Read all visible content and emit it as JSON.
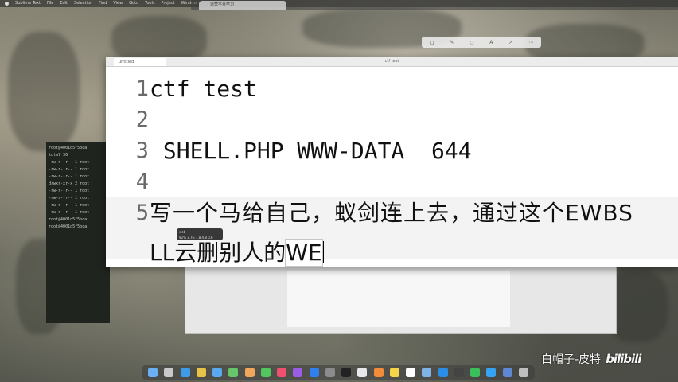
{
  "menubar": {
    "app_name": "Sublime Text",
    "items": [
      "File",
      "Edit",
      "Selection",
      "Find",
      "View",
      "Goto",
      "Tools",
      "Project",
      "Window"
    ]
  },
  "browser": {
    "tab_title": "运营平台学习",
    "toolbar_icons": [
      "crop-icon",
      "pen-icon",
      "shapes-icon",
      "text-icon",
      "arrow-icon",
      "more-icon"
    ]
  },
  "terminal": {
    "lines": [
      "root@4001d5f5bca:",
      "total 36",
      "-rw-r--r-- 1 root",
      "-rw-r--r-- 1 root",
      "-rw-r--r-- 1 root",
      "drwxr-xr-x 2 root",
      "-rw-r--r-- 1 root",
      "-rw-r--r-- 1 root",
      "-rw-r--r-- 1 root",
      "-rw-r--r-- 1 root",
      "root@4001d5f5bca:",
      "root@4001d5f5bca:"
    ]
  },
  "editor": {
    "tab_label": "untitled",
    "window_title": "ctf test",
    "lines": [
      {
        "num": "1",
        "text": "ctf test"
      },
      {
        "num": "2",
        "text": ""
      },
      {
        "num": "3",
        "text": " SHELL.PHP WWW-DATA  644"
      },
      {
        "num": "4",
        "text": ""
      },
      {
        "num": "5",
        "text": "写一个马给自己，蚁剑连上去，通过这个EWBS"
      }
    ],
    "wrap_text": "LL云删别人的",
    "wrap_selected": "WE"
  },
  "ime_popup": {
    "title": "web",
    "values": "92%  3.7G  1.8  4.8  0.6"
  },
  "dock": {
    "icons": [
      "finder-icon",
      "launchpad-icon",
      "safari-icon",
      "chrome-icon",
      "mail-icon",
      "maps-icon",
      "photos-icon",
      "messages-icon",
      "music-icon",
      "podcast-icon",
      "appstore-icon",
      "settings-icon",
      "terminal-icon",
      "textedit-icon",
      "sublime-icon",
      "notes-icon",
      "calendar-icon",
      "preview-icon",
      "vscode-icon",
      "typora-icon",
      "wechat-icon",
      "qq-icon",
      "finder2-icon",
      "trash-icon"
    ]
  },
  "watermark": {
    "author": "白帽子-皮特",
    "logo": "bilibili"
  },
  "colors": {
    "editor_bg": "#ffffff",
    "gutter_text": "#6a6a6a",
    "code_text": "#111111",
    "terminal_bg": "#1f241f"
  }
}
